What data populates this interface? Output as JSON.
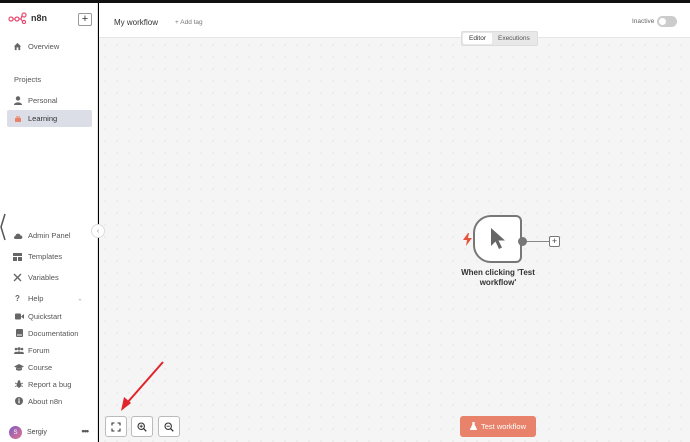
{
  "app": {
    "brand_name": "n8n"
  },
  "sidebar": {
    "add_label": "+",
    "overview": "Overview",
    "projects_title": "Projects",
    "personal": "Personal",
    "learning": "Learning",
    "bottom_items": [
      {
        "label": "Admin Panel",
        "icon": "cloud-icon"
      },
      {
        "label": "Templates",
        "icon": "templates-icon"
      },
      {
        "label": "Variables",
        "icon": "variables-icon"
      },
      {
        "label": "Help",
        "icon": "help-icon"
      }
    ],
    "help_items": [
      {
        "label": "Quickstart",
        "icon": "video-icon"
      },
      {
        "label": "Documentation",
        "icon": "book-icon"
      },
      {
        "label": "Forum",
        "icon": "users-icon"
      },
      {
        "label": "Course",
        "icon": "graduation-icon"
      },
      {
        "label": "Report a bug",
        "icon": "bug-icon"
      },
      {
        "label": "About n8n",
        "icon": "info-icon"
      }
    ],
    "user": {
      "initials": "S",
      "name": "Sergiy",
      "more": "•••"
    }
  },
  "header": {
    "workflow_name": "My workflow",
    "add_tag": "+ Add tag",
    "status_label": "Inactive",
    "tabs": [
      {
        "label": "Editor",
        "active": true
      },
      {
        "label": "Executions",
        "active": false
      }
    ]
  },
  "canvas": {
    "node": {
      "label_line1": "When clicking 'Test",
      "label_line2": "workflow'"
    },
    "test_button": "Test workflow"
  },
  "colors": {
    "accent": "#e8826a",
    "brand": "#ea4b71",
    "annotation_arrow": "#e0242b"
  }
}
